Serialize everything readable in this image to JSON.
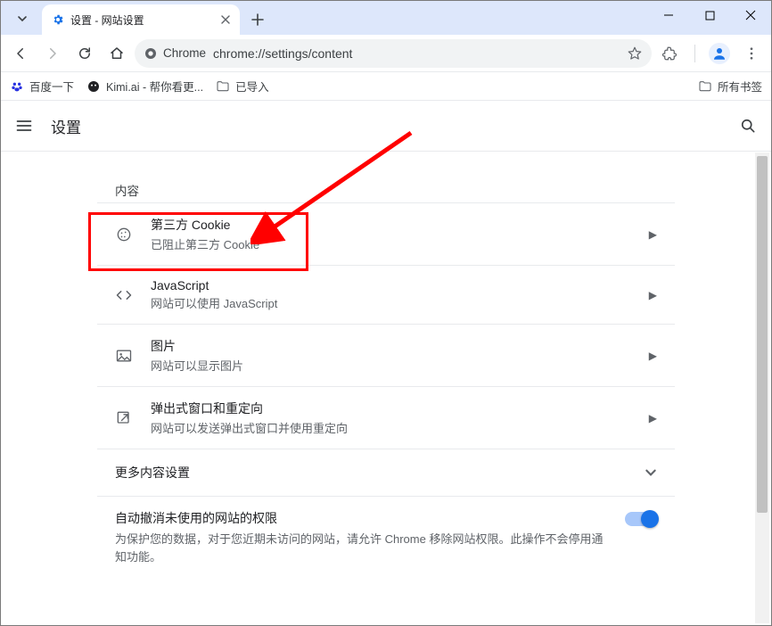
{
  "tab": {
    "title": "设置 - 网站设置"
  },
  "address": {
    "chip_label": "Chrome",
    "url": "chrome://settings/content"
  },
  "bookmarks": {
    "items": [
      {
        "label": "百度一下"
      },
      {
        "label": "Kimi.ai - 帮你看更..."
      },
      {
        "label": "已导入"
      }
    ],
    "all": "所有书签"
  },
  "settings": {
    "title": "设置"
  },
  "content": {
    "section_title": "内容",
    "rows": [
      {
        "title": "第三方 Cookie",
        "subtitle": "已阻止第三方 Cookie"
      },
      {
        "title": "JavaScript",
        "subtitle": "网站可以使用 JavaScript"
      },
      {
        "title": "图片",
        "subtitle": "网站可以显示图片"
      },
      {
        "title": "弹出式窗口和重定向",
        "subtitle": "网站可以发送弹出式窗口并使用重定向"
      }
    ],
    "more": "更多内容设置",
    "perm": {
      "title": "自动撤消未使用的网站的权限",
      "subtitle": "为保护您的数据，对于您近期未访问的网站，请允许 Chrome 移除网站权限。此操作不会停用通知功能。"
    }
  }
}
